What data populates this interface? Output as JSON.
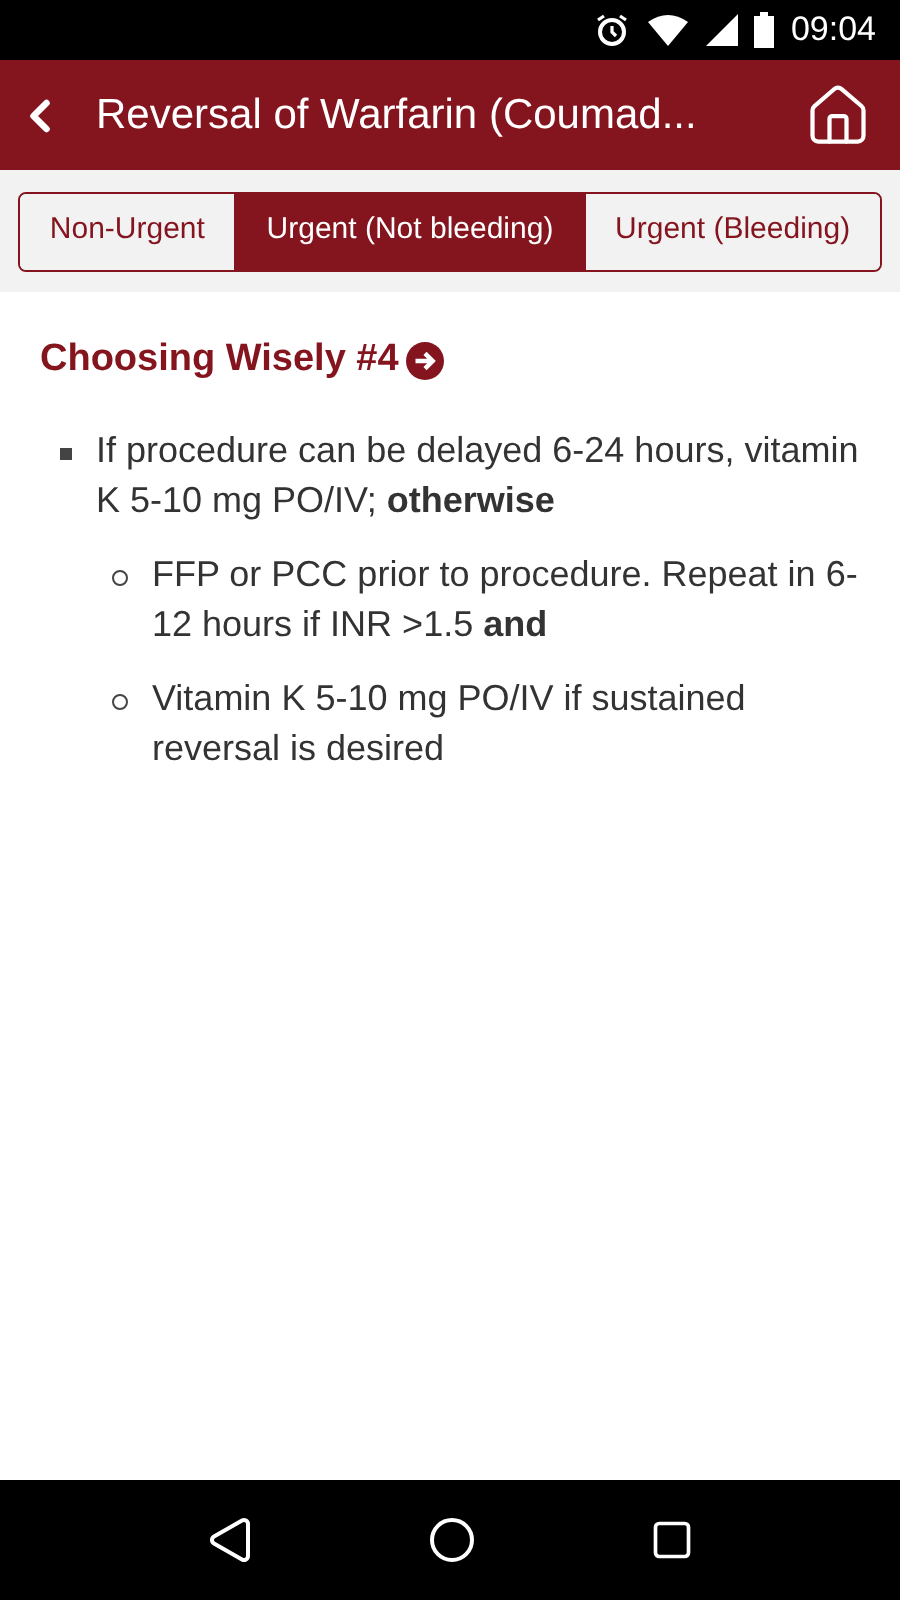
{
  "status_bar": {
    "time": "09:04"
  },
  "header": {
    "title": "Reversal of Warfarin (Coumad..."
  },
  "tabs": [
    {
      "label": "Non-Urgent",
      "selected": false
    },
    {
      "label": "Urgent (Not bleeding)",
      "selected": true
    },
    {
      "label": "Urgent (Bleeding)",
      "selected": false
    }
  ],
  "section": {
    "title": "Choosing Wisely #4",
    "items": [
      {
        "text": "If procedure can be delayed 6-24 hours, vitamin K 5-10 mg PO/IV; **otherwise**",
        "children": [
          {
            "text": "FFP or PCC prior to procedure. Repeat in 6-12 hours if INR >1.5 **and**"
          },
          {
            "text": "Vitamin K 5-10 mg PO/IV if sustained reversal is desired"
          }
        ]
      }
    ]
  }
}
